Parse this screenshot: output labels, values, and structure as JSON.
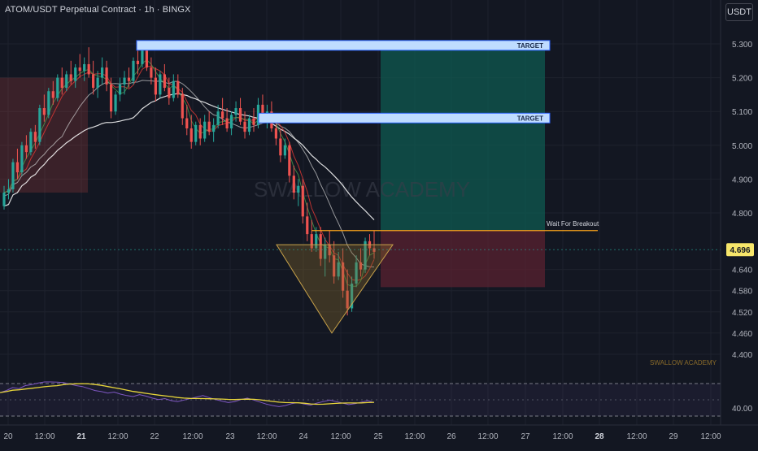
{
  "header": {
    "symbol_title": "ATOM/USDT Perpetual Contract · 1h · BINGX",
    "unit": "USDT"
  },
  "watermark": "SWALLOW ACADEMY",
  "brand_text": "SWALLOW ACADEMY",
  "colors": {
    "background": "#131722",
    "up": "#26a69a",
    "down": "#ef5350",
    "target_fill": "#bfdcff",
    "target_border": "#2962ff",
    "profit_zone": "#0f5a50",
    "loss_zone": "#5a2230",
    "breakout_line": "#f7a21b",
    "triangle": "#8a6b2a",
    "rsi_line": "#7e57c2",
    "rsi_ma": "#e8d63a",
    "ma_fast": "#4caf50",
    "ma_slow": "#ffffff",
    "ema_red": "#e53935"
  },
  "chart_data": {
    "type": "candlestick",
    "title": "ATOM/USDT Perpetual Contract · 1h · BINGX",
    "y_unit": "USDT",
    "y_ticks": [
      5.3,
      5.2,
      5.1,
      5.0,
      4.9,
      4.8,
      4.64,
      4.58,
      4.52,
      4.46,
      4.4
    ],
    "y_tick_labels": [
      "5.300",
      "5.200",
      "5.100",
      "5.000",
      "4.900",
      "4.800",
      "4.640",
      "4.580",
      "4.520",
      "4.460",
      "4.400"
    ],
    "x_tick_labels": [
      "20",
      "12:00",
      "21",
      "12:00",
      "22",
      "12:00",
      "23",
      "12:00",
      "24",
      "12:00",
      "25",
      "12:00",
      "26",
      "12:00",
      "27",
      "12:00",
      "28",
      "12:00",
      "29",
      "12:00"
    ],
    "bold_x_labels": [
      "21",
      "28"
    ],
    "current_price": "4.696",
    "annotations": {
      "targets": [
        {
          "label": "TARGET",
          "price_low": 5.29,
          "price_high": 5.31
        },
        {
          "label": "TARGET",
          "price_low": 5.075,
          "price_high": 5.095
        }
      ],
      "breakout": {
        "label": "Wait For Breakout",
        "price": 4.75
      },
      "profit_zone": {
        "top": 5.305,
        "bottom": 4.75
      },
      "loss_zone": {
        "top": 4.75,
        "bottom": 4.59
      },
      "triangle": {
        "top": 4.71,
        "bottom": 4.46
      }
    },
    "candles": [
      [
        4.82,
        4.88,
        4.81,
        4.86
      ],
      [
        4.86,
        4.9,
        4.84,
        4.87
      ],
      [
        4.87,
        4.96,
        4.86,
        4.95
      ],
      [
        4.95,
        4.99,
        4.9,
        4.92
      ],
      [
        4.92,
        5.01,
        4.91,
        5.0
      ],
      [
        5.0,
        5.03,
        4.96,
        4.98
      ],
      [
        4.98,
        5.05,
        4.97,
        5.04
      ],
      [
        5.04,
        5.06,
        4.99,
        5.01
      ],
      [
        5.01,
        5.12,
        5.0,
        5.11
      ],
      [
        5.11,
        5.15,
        5.07,
        5.09
      ],
      [
        5.09,
        5.17,
        5.08,
        5.16
      ],
      [
        5.16,
        5.19,
        5.12,
        5.14
      ],
      [
        5.14,
        5.21,
        5.13,
        5.2
      ],
      [
        5.2,
        5.23,
        5.15,
        5.17
      ],
      [
        5.17,
        5.22,
        5.16,
        5.21
      ],
      [
        5.21,
        5.25,
        5.18,
        5.19
      ],
      [
        5.19,
        5.24,
        5.17,
        5.23
      ],
      [
        5.23,
        5.27,
        5.2,
        5.22
      ],
      [
        5.22,
        5.26,
        5.19,
        5.24
      ],
      [
        5.24,
        5.29,
        5.2,
        5.21
      ],
      [
        5.21,
        5.25,
        5.15,
        5.17
      ],
      [
        5.17,
        5.22,
        5.14,
        5.2
      ],
      [
        5.2,
        5.26,
        5.18,
        5.23
      ],
      [
        5.23,
        5.25,
        5.16,
        5.18
      ],
      [
        5.18,
        5.2,
        5.08,
        5.1
      ],
      [
        5.1,
        5.16,
        5.09,
        5.15
      ],
      [
        5.15,
        5.2,
        5.13,
        5.18
      ],
      [
        5.18,
        5.22,
        5.15,
        5.2
      ],
      [
        5.2,
        5.23,
        5.17,
        5.19
      ],
      [
        5.19,
        5.26,
        5.18,
        5.25
      ],
      [
        5.25,
        5.28,
        5.21,
        5.24
      ],
      [
        5.24,
        5.3,
        5.23,
        5.29
      ],
      [
        5.29,
        5.31,
        5.22,
        5.23
      ],
      [
        5.23,
        5.26,
        5.18,
        5.2
      ],
      [
        5.2,
        5.23,
        5.13,
        5.15
      ],
      [
        5.15,
        5.22,
        5.14,
        5.21
      ],
      [
        5.21,
        5.24,
        5.16,
        5.17
      ],
      [
        5.17,
        5.2,
        5.12,
        5.14
      ],
      [
        5.14,
        5.21,
        5.13,
        5.19
      ],
      [
        5.19,
        5.21,
        5.14,
        5.15
      ],
      [
        5.15,
        5.17,
        5.06,
        5.08
      ],
      [
        5.08,
        5.12,
        5.03,
        5.05
      ],
      [
        5.05,
        5.09,
        4.99,
        5.01
      ],
      [
        5.01,
        5.07,
        5.0,
        5.06
      ],
      [
        5.06,
        5.08,
        5.0,
        5.02
      ],
      [
        5.02,
        5.09,
        5.01,
        5.07
      ],
      [
        5.07,
        5.1,
        5.03,
        5.04
      ],
      [
        5.04,
        5.08,
        5.01,
        5.06
      ],
      [
        5.06,
        5.12,
        5.05,
        5.1
      ],
      [
        5.1,
        5.14,
        5.06,
        5.08
      ],
      [
        5.08,
        5.11,
        5.04,
        5.05
      ],
      [
        5.05,
        5.1,
        5.03,
        5.09
      ],
      [
        5.09,
        5.13,
        5.07,
        5.11
      ],
      [
        5.11,
        5.14,
        5.06,
        5.07
      ],
      [
        5.07,
        5.1,
        5.02,
        5.04
      ],
      [
        5.04,
        5.09,
        5.03,
        5.08
      ],
      [
        5.08,
        5.11,
        5.04,
        5.06
      ],
      [
        5.06,
        5.14,
        5.05,
        5.12
      ],
      [
        5.12,
        5.15,
        5.07,
        5.09
      ],
      [
        5.09,
        5.12,
        5.05,
        5.1
      ],
      [
        5.1,
        5.13,
        5.04,
        5.05
      ],
      [
        5.05,
        5.08,
        5.0,
        5.02
      ],
      [
        5.02,
        5.05,
        4.95,
        4.97
      ],
      [
        4.97,
        5.02,
        4.96,
        5.0
      ],
      [
        5.0,
        5.01,
        4.89,
        4.91
      ],
      [
        4.91,
        4.94,
        4.84,
        4.86
      ],
      [
        4.86,
        4.9,
        4.82,
        4.88
      ],
      [
        4.88,
        4.9,
        4.77,
        4.79
      ],
      [
        4.79,
        4.83,
        4.72,
        4.74
      ],
      [
        4.74,
        4.78,
        4.69,
        4.7
      ],
      [
        4.7,
        4.76,
        4.69,
        4.74
      ],
      [
        4.74,
        4.76,
        4.65,
        4.67
      ],
      [
        4.67,
        4.73,
        4.62,
        4.71
      ],
      [
        4.71,
        4.75,
        4.66,
        4.68
      ],
      [
        4.68,
        4.72,
        4.6,
        4.62
      ],
      [
        4.62,
        4.69,
        4.61,
        4.66
      ],
      [
        4.66,
        4.7,
        4.56,
        4.58
      ],
      [
        4.58,
        4.64,
        4.51,
        4.53
      ],
      [
        4.53,
        4.62,
        4.52,
        4.6
      ],
      [
        4.6,
        4.68,
        4.59,
        4.66
      ],
      [
        4.66,
        4.7,
        4.62,
        4.64
      ],
      [
        4.64,
        4.73,
        4.63,
        4.72
      ],
      [
        4.72,
        4.74,
        4.68,
        4.7
      ],
      [
        4.7,
        4.75,
        4.67,
        4.69
      ]
    ],
    "rsi": {
      "y_tick_labels": [
        "40.00"
      ],
      "values": [
        56,
        60,
        66,
        64,
        70,
        72,
        75,
        78,
        80,
        77,
        76,
        73,
        70,
        68,
        64,
        60,
        58,
        55,
        57,
        53,
        50,
        48,
        52,
        49,
        45,
        42,
        44,
        40,
        38,
        41,
        44,
        47,
        50,
        46,
        42,
        39,
        36,
        38,
        42,
        45,
        41,
        37,
        33,
        30,
        28,
        30,
        34,
        36,
        33,
        31,
        35,
        38,
        41,
        38,
        35,
        32,
        34,
        37,
        40,
        36
      ]
    }
  }
}
